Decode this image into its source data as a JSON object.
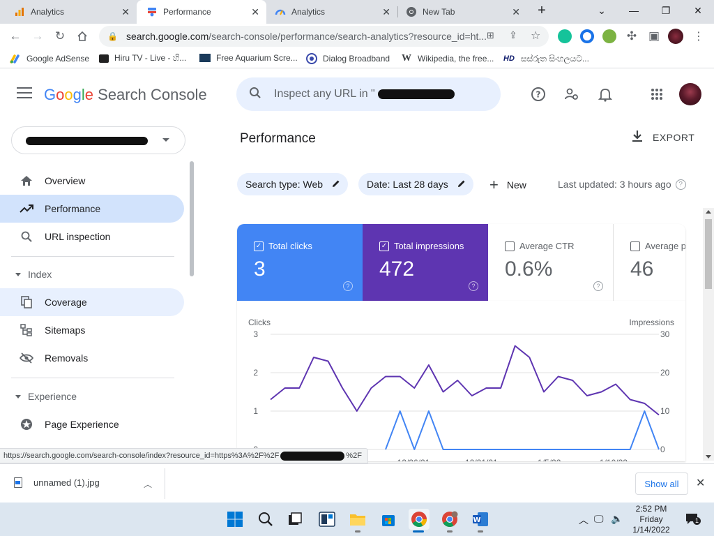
{
  "browser": {
    "tabs": [
      {
        "title": "Analytics",
        "icon": "analytics-bars-icon",
        "active": false
      },
      {
        "title": "Performance",
        "icon": "search-console-icon",
        "active": true
      },
      {
        "title": "Analytics",
        "icon": "analytics-gauge-icon",
        "active": false
      },
      {
        "title": "New Tab",
        "icon": "chrome-icon",
        "active": false
      }
    ],
    "new_tab_symbol": "+",
    "url_host": "search.google.com",
    "url_path": "/search-console/performance/search-analytics?resource_id=ht...",
    "bookmarks": [
      {
        "label": "Google AdSense",
        "icon": "adsense-icon"
      },
      {
        "label": "Hiru TV - Live - හි...",
        "icon": "hiru-tv-icon"
      },
      {
        "label": "Free Aquarium Scre...",
        "icon": "aquarium-icon"
      },
      {
        "label": "Dialog Broadband",
        "icon": "dialog-icon"
      },
      {
        "label": "Wikipedia, the free...",
        "icon": "wikipedia-icon",
        "glyph": "W"
      },
      {
        "label": "සස්රුත සිංහලයට...",
        "icon": "hd-icon",
        "glyph": "HD"
      }
    ]
  },
  "app": {
    "brand_google": [
      "G",
      "o",
      "o",
      "g",
      "l",
      "e"
    ],
    "brand_product": "Search Console",
    "inspect_placeholder": "Inspect any URL in \""
  },
  "sidebar": {
    "items": [
      {
        "label": "Overview",
        "icon": "home-icon"
      },
      {
        "label": "Performance",
        "icon": "trending-up-icon",
        "active": true
      },
      {
        "label": "URL inspection",
        "icon": "search-icon"
      }
    ],
    "sections": [
      {
        "title": "Index",
        "items": [
          {
            "label": "Coverage",
            "icon": "file-copy-icon"
          },
          {
            "label": "Sitemaps",
            "icon": "sitemap-icon"
          },
          {
            "label": "Removals",
            "icon": "visibility-off-icon"
          }
        ]
      },
      {
        "title": "Experience",
        "items": [
          {
            "label": "Page Experience",
            "icon": "page-experience-icon"
          }
        ]
      }
    ]
  },
  "main": {
    "title": "Performance",
    "export_label": "EXPORT",
    "filters": [
      {
        "label": "Search type: Web"
      },
      {
        "label": "Date: Last 28 days"
      }
    ],
    "new_label": "New",
    "last_updated": "Last updated: 3 hours ago",
    "metrics": [
      {
        "label": "Total clicks",
        "value": "3",
        "checked": true,
        "color": "#4285f4"
      },
      {
        "label": "Total impressions",
        "value": "472",
        "checked": true,
        "color": "#5e35b1"
      },
      {
        "label": "Average CTR",
        "value": "0.6%",
        "checked": false,
        "color": "#ffffff"
      },
      {
        "label": "Average po",
        "value": "46",
        "checked": false,
        "color": "#ffffff"
      }
    ]
  },
  "chart_data": {
    "type": "line",
    "left_axis_label": "Clicks",
    "right_axis_label": "Impressions",
    "left_ticks": [
      "3",
      "2",
      "1",
      "0"
    ],
    "right_ticks": [
      "30",
      "20",
      "10",
      "0"
    ],
    "ylim_left": [
      0,
      3
    ],
    "ylim_right": [
      0,
      30
    ],
    "x_ticks": [
      "12/26/21",
      "12/31/21",
      "1/5/22",
      "1/10/22"
    ],
    "series": [
      {
        "name": "Impressions",
        "axis": "right",
        "color": "#5e35b1",
        "values": [
          13,
          16,
          16,
          24,
          23,
          16,
          10,
          16,
          19,
          19,
          16,
          22,
          15,
          18,
          14,
          16,
          16,
          27,
          24,
          15,
          19,
          18,
          14,
          15,
          17,
          13,
          12,
          9
        ]
      },
      {
        "name": "Clicks",
        "axis": "left",
        "color": "#4285f4",
        "values": [
          null,
          null,
          null,
          null,
          null,
          null,
          null,
          null,
          0,
          1,
          0,
          1,
          0,
          0,
          0,
          0,
          0,
          0,
          0,
          0,
          0,
          0,
          0,
          0,
          0,
          0,
          1,
          0
        ]
      }
    ]
  },
  "status_url": "https://search.google.com/search-console/index?resource_id=https%3A%2F%2F",
  "status_url_tail": "%2F",
  "downloads": {
    "file": "unnamed (1).jpg",
    "show_all": "Show all"
  },
  "taskbar": {
    "time": "2:52 PM",
    "day": "Friday",
    "date": "1/14/2022",
    "notification_count": "1"
  }
}
